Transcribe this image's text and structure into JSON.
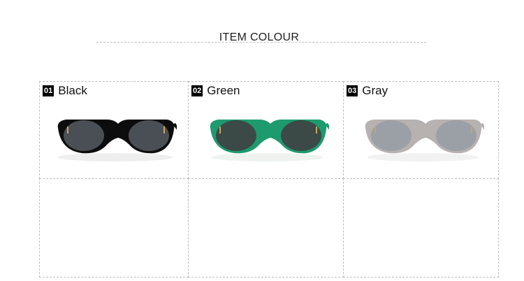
{
  "header": {
    "title": "ITEM COLOUR"
  },
  "items": [
    {
      "number": "01",
      "name": "Black",
      "frame_color": "#0d0d0d",
      "lens_color": "#4a4f55"
    },
    {
      "number": "02",
      "name": "Green",
      "frame_color": "#1e9a6f",
      "lens_color": "#3b4a46"
    },
    {
      "number": "03",
      "name": "Gray",
      "frame_color": "#b7b1b0",
      "lens_color": "#9aa0a6"
    }
  ]
}
